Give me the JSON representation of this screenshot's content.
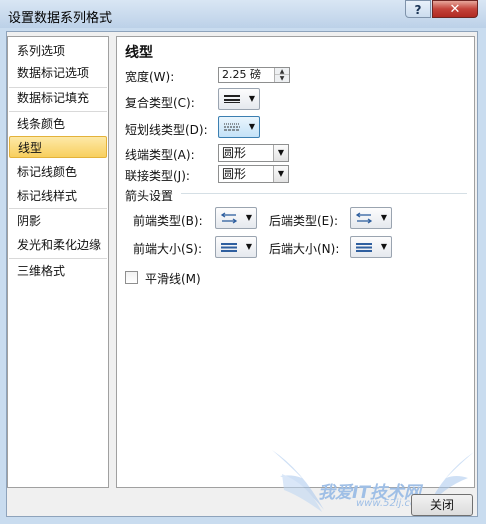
{
  "window": {
    "title": "设置数据系列格式",
    "help_label": "?",
    "close_label": "✕"
  },
  "sidebar": {
    "items": [
      {
        "label": "系列选项"
      },
      {
        "label": "数据标记选项"
      },
      {
        "label": "数据标记填充"
      },
      {
        "label": "线条颜色"
      },
      {
        "label": "线型",
        "selected": true
      },
      {
        "label": "标记线颜色"
      },
      {
        "label": "标记线样式"
      },
      {
        "label": "阴影"
      },
      {
        "label": "发光和柔化边缘"
      },
      {
        "label": "三维格式"
      }
    ]
  },
  "panel": {
    "heading": "线型",
    "width": {
      "label": "宽度(W):",
      "value": "2.25 磅"
    },
    "compound": {
      "label": "复合类型(C):"
    },
    "dash": {
      "label": "短划线类型(D):"
    },
    "cap": {
      "label": "线端类型(A):",
      "value": "圆形"
    },
    "join": {
      "label": "联接类型(J):",
      "value": "圆形"
    },
    "arrows": {
      "label": "箭头设置",
      "begin_type": {
        "label": "前端类型(B):"
      },
      "end_type": {
        "label": "后端类型(E):"
      },
      "begin_size": {
        "label": "前端大小(S):"
      },
      "end_size": {
        "label": "后端大小(N):"
      }
    },
    "smoothed": {
      "label": "平滑线(M)",
      "checked": false
    }
  },
  "footer": {
    "close_label": "关闭"
  },
  "watermark": {
    "text": "我爱IT技术网",
    "url": "www.52ij.com"
  },
  "colors": {
    "selection": "#f8cf5e",
    "title_bar": "#c9dcef",
    "close_button": "#c3433a"
  },
  "icons": {
    "compound": "compound-lines-icon",
    "dash": "dash-lines-icon",
    "arrow_type": "arrow-type-icon",
    "arrow_size": "arrow-size-icon"
  }
}
